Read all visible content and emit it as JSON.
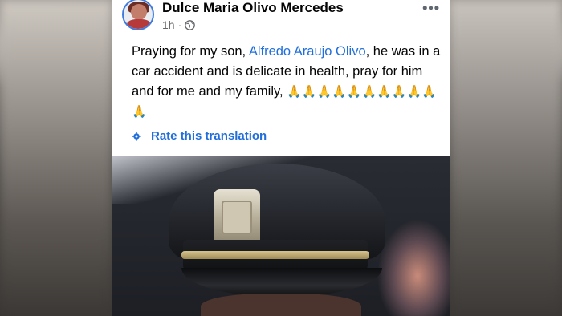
{
  "post": {
    "author": "Dulce Maria Olivo Mercedes",
    "time": "1h",
    "time_separator": "·",
    "more_label": "•••",
    "text_before_link": "Praying for my son, ",
    "link_text": "Alfredo Araujo Olivo",
    "text_after_link": ", he was in a car accident and is delicate in health, pray for him and for me and my family, ",
    "emojis": "🙏🙏🙏🙏🙏🙏🙏🙏🙏🙏🙏",
    "rate_label": "Rate this translation",
    "icons": [
      "globe-icon",
      "gear-icon",
      "more-options-icon"
    ],
    "colors": {
      "link": "#216fdb",
      "text": "#050505",
      "meta": "#65676b"
    }
  }
}
